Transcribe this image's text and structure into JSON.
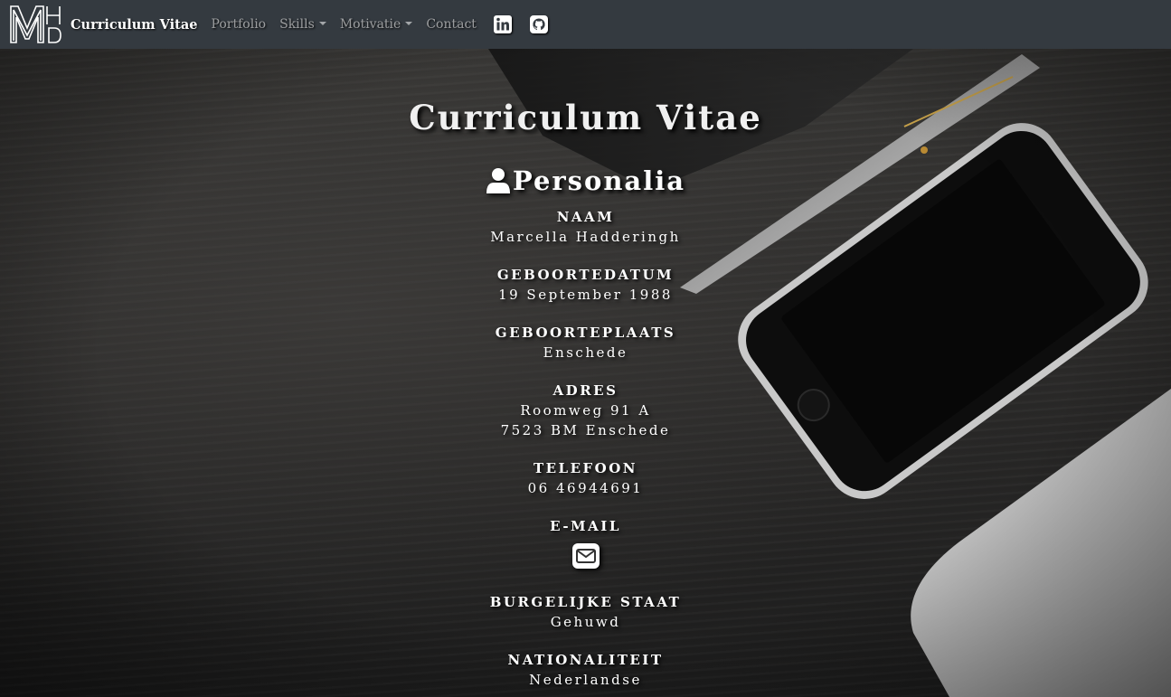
{
  "navbar": {
    "logo_text": "MHD",
    "brand": "Curriculum Vitae",
    "links": [
      {
        "label": "Portfolio",
        "dropdown": false
      },
      {
        "label": "Skills",
        "dropdown": true
      },
      {
        "label": "Motivatie",
        "dropdown": true
      },
      {
        "label": "Contact",
        "dropdown": false
      }
    ],
    "icons": [
      "linkedin-icon",
      "github-icon"
    ],
    "background": "#343a40"
  },
  "main": {
    "title": "Curriculum Vitae",
    "section": {
      "icon": "user-icon",
      "title": "Personalia"
    },
    "fields": {
      "naam": {
        "label": "NAAM",
        "value": "Marcella Hadderingh"
      },
      "geboortedatum": {
        "label": "GEBOORTEDATUM",
        "value": "19 September 1988"
      },
      "geboorteplaats": {
        "label": "GEBOORTEPLAATS",
        "value": "Enschede"
      },
      "adres": {
        "label": "ADRES",
        "line1": "Roomweg 91 A",
        "line2": "7523 BM Enschede"
      },
      "telefoon": {
        "label": "TELEFOON",
        "value": "06 46944691"
      },
      "email": {
        "label": "E-MAIL",
        "icon": "envelope-icon"
      },
      "burgerlijke_staat": {
        "label": "BURGELIJKE STAAT",
        "value": "Gehuwd"
      },
      "nationaliteit": {
        "label": "NATIONALITEIT",
        "value": "Nederlandse"
      }
    }
  }
}
